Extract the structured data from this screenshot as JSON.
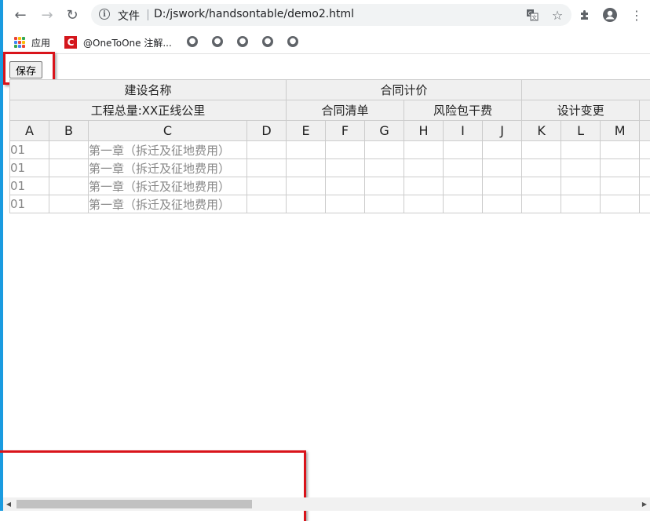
{
  "browser": {
    "address_label": "文件",
    "url": "D:/jswork/handsontable/demo2.html",
    "bookmarks": [
      {
        "label": "应用"
      },
      {
        "label": "@OneToOne 注解..."
      }
    ]
  },
  "page": {
    "save_label": "保存"
  },
  "grid": {
    "nested_row1": [
      {
        "label": "建设名称",
        "span": 4
      },
      {
        "label": "合同计价",
        "span": 6
      },
      {
        "label": "",
        "span": 4
      }
    ],
    "nested_row2": [
      {
        "label": "工程总量:XX正线公里",
        "span": 4
      },
      {
        "label": "合同清单",
        "span": 3
      },
      {
        "label": "风险包干费",
        "span": 3
      },
      {
        "label": "设计变更",
        "span": 3
      },
      {
        "label": "",
        "span": 1
      }
    ],
    "columns": [
      "A",
      "B",
      "C",
      "D",
      "E",
      "F",
      "G",
      "H",
      "I",
      "J",
      "K",
      "L",
      "M",
      ""
    ],
    "rows": [
      [
        "01",
        "",
        "第一章（拆迁及征地费用）",
        "",
        "",
        "",
        "",
        "",
        "",
        "",
        "",
        "",
        "",
        ""
      ],
      [
        "01",
        "",
        "第一章（拆迁及征地费用）",
        "",
        "",
        "",
        "",
        "",
        "",
        "",
        "",
        "",
        "",
        ""
      ],
      [
        "01",
        "",
        "第一章（拆迁及征地费用）",
        "",
        "",
        "",
        "",
        "",
        "",
        "",
        "",
        "",
        "",
        ""
      ],
      [
        "01",
        "",
        "第一章（拆迁及征地费用）",
        "",
        "",
        "",
        "",
        "",
        "",
        "",
        "",
        "",
        "",
        ""
      ]
    ]
  },
  "colors": {
    "highlight": "#d9141b",
    "accent_bar": "#1a9be0"
  }
}
